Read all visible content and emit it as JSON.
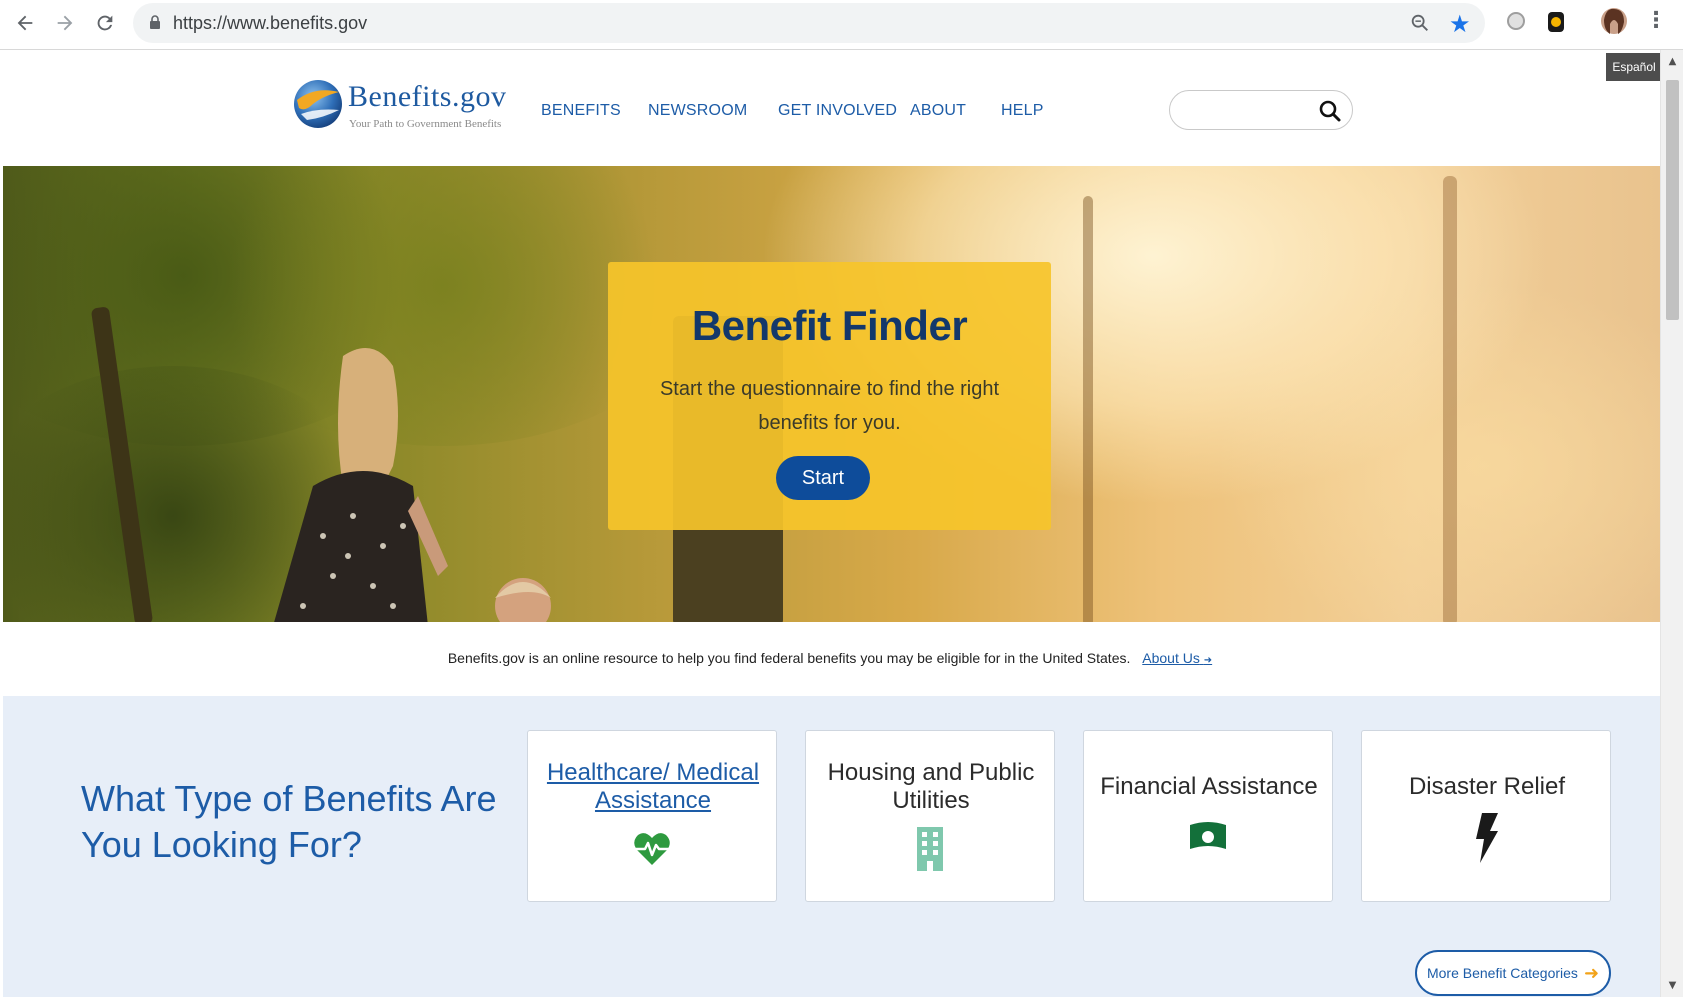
{
  "browser": {
    "url": "https://www.benefits.gov",
    "back_icon": "arrow-left-icon",
    "forward_icon": "arrow-right-icon",
    "reload_icon": "reload-icon"
  },
  "site": {
    "logo_text": "Benefits.gov",
    "tagline": "Your Path to Government Benefits",
    "language_toggle": "Español"
  },
  "nav": {
    "items": [
      {
        "label": "BENEFITS"
      },
      {
        "label": "NEWSROOM"
      },
      {
        "label": "GET INVOLVED"
      },
      {
        "label": "ABOUT"
      },
      {
        "label": "HELP"
      }
    ]
  },
  "search": {
    "placeholder": "",
    "value": ""
  },
  "hero": {
    "title": "Benefit Finder",
    "description": "Start the questionnaire to find the right benefits for you.",
    "button": "Start"
  },
  "intro": {
    "text": "Benefits.gov is an online resource to help you find federal benefits you may be eligible for in the United States.",
    "link": "About Us",
    "link_arrow": "➜"
  },
  "categories": {
    "heading": "What Type of Benefits Are You Looking For?",
    "cards": [
      {
        "label": "Healthcare/ Medical Assistance",
        "icon": "heartbeat-icon",
        "color": "#2e9a3f"
      },
      {
        "label": "Housing and Public Utilities",
        "icon": "building-icon",
        "color": "#7fc8ad"
      },
      {
        "label": "Financial Assistance",
        "icon": "money-icon",
        "color": "#13703a"
      },
      {
        "label": "Disaster Relief",
        "icon": "lightning-icon",
        "color": "#1a1a1a"
      }
    ],
    "more_button": "More Benefit Categories",
    "more_arrow": "➜"
  },
  "colors": {
    "brand_blue": "#1d5ca7",
    "finder_yellow": "#f6c42a",
    "start_button": "#0e4c9a",
    "categories_bg": "#e7eef8"
  }
}
